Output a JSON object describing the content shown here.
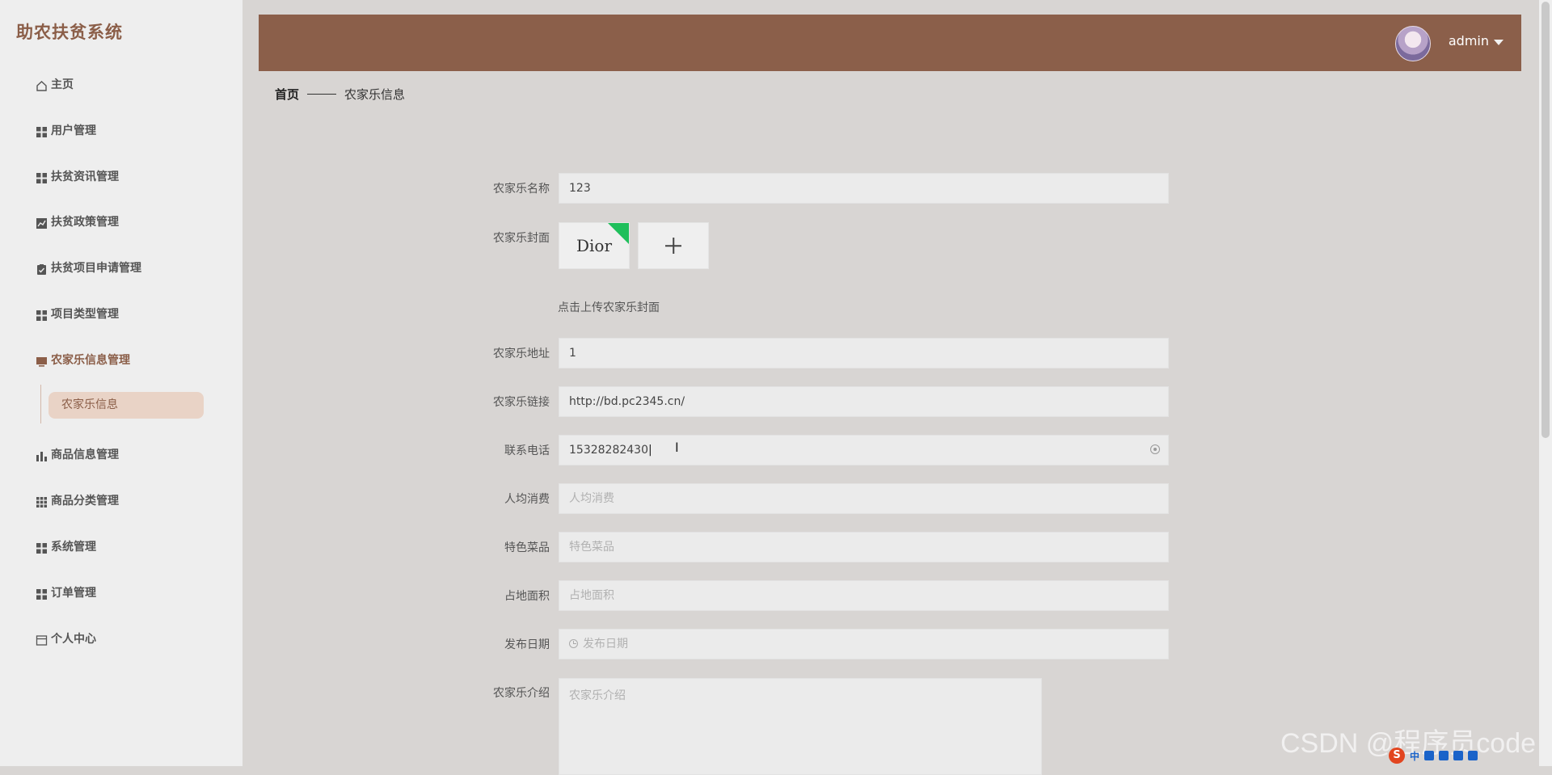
{
  "app": {
    "title": "助农扶贫系统"
  },
  "sidebar": {
    "items": [
      {
        "label": "主页",
        "icon": "home-icon"
      },
      {
        "label": "用户管理",
        "icon": "grid-icon"
      },
      {
        "label": "扶贫资讯管理",
        "icon": "grid-icon"
      },
      {
        "label": "扶贫政策管理",
        "icon": "chart-icon"
      },
      {
        "label": "扶贫项目申请管理",
        "icon": "clipboard-icon"
      },
      {
        "label": "项目类型管理",
        "icon": "grid-icon"
      },
      {
        "label": "农家乐信息管理",
        "icon": "monitor-icon"
      },
      {
        "label": "商品信息管理",
        "icon": "bar-chart-icon"
      },
      {
        "label": "商品分类管理",
        "icon": "grid9-icon"
      },
      {
        "label": "系统管理",
        "icon": "grid-icon"
      },
      {
        "label": "订单管理",
        "icon": "grid-icon"
      },
      {
        "label": "个人中心",
        "icon": "window-icon"
      }
    ],
    "submenu": {
      "label": "农家乐信息"
    }
  },
  "header": {
    "username": "admin"
  },
  "breadcrumb": {
    "home": "首页",
    "current": "农家乐信息"
  },
  "form": {
    "name": {
      "label": "农家乐名称",
      "value": "123"
    },
    "cover": {
      "label": "农家乐封面",
      "thumb_text": "Dior",
      "tip": "点击上传农家乐封面"
    },
    "address": {
      "label": "农家乐地址",
      "value": "1"
    },
    "link": {
      "label": "农家乐链接",
      "value": "http://bd.pc2345.cn/"
    },
    "phone": {
      "label": "联系电话",
      "value": "15328282430"
    },
    "avg_cost": {
      "label": "人均消费",
      "placeholder": "人均消费"
    },
    "dishes": {
      "label": "特色菜品",
      "placeholder": "特色菜品"
    },
    "area": {
      "label": "占地面积",
      "placeholder": "占地面积"
    },
    "publish_date": {
      "label": "发布日期",
      "placeholder": "发布日期"
    },
    "intro": {
      "label": "农家乐介绍",
      "placeholder": "农家乐介绍"
    }
  },
  "watermark": "CSDN @程序员code",
  "ime": {
    "mode": "中"
  },
  "colors": {
    "accent": "#8b5f4a",
    "sidebar_bg": "#eeeeee",
    "active_sub_bg": "#e9d3c6",
    "field_bg": "#ebebeb"
  }
}
